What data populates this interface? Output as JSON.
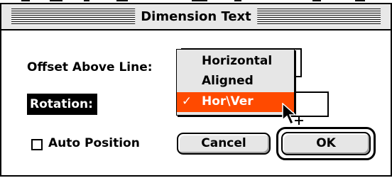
{
  "window": {
    "title": "Dimension Text"
  },
  "fields": {
    "offset_label": "Offset Above Line:",
    "rotation_label": "Rotation:",
    "auto_position_label": "Auto Position",
    "auto_position_checked": false
  },
  "popup_menu": {
    "items": [
      {
        "label": "Horizontal",
        "checked": false
      },
      {
        "label": "Aligned",
        "checked": false
      },
      {
        "label": "Hor\\Ver",
        "checked": true,
        "check_mark": "✓"
      }
    ],
    "highlight_color": "#ff4a00"
  },
  "buttons": {
    "cancel": "Cancel",
    "ok": "OK"
  },
  "icons": {
    "cursor": "arrow-cursor-icon"
  }
}
